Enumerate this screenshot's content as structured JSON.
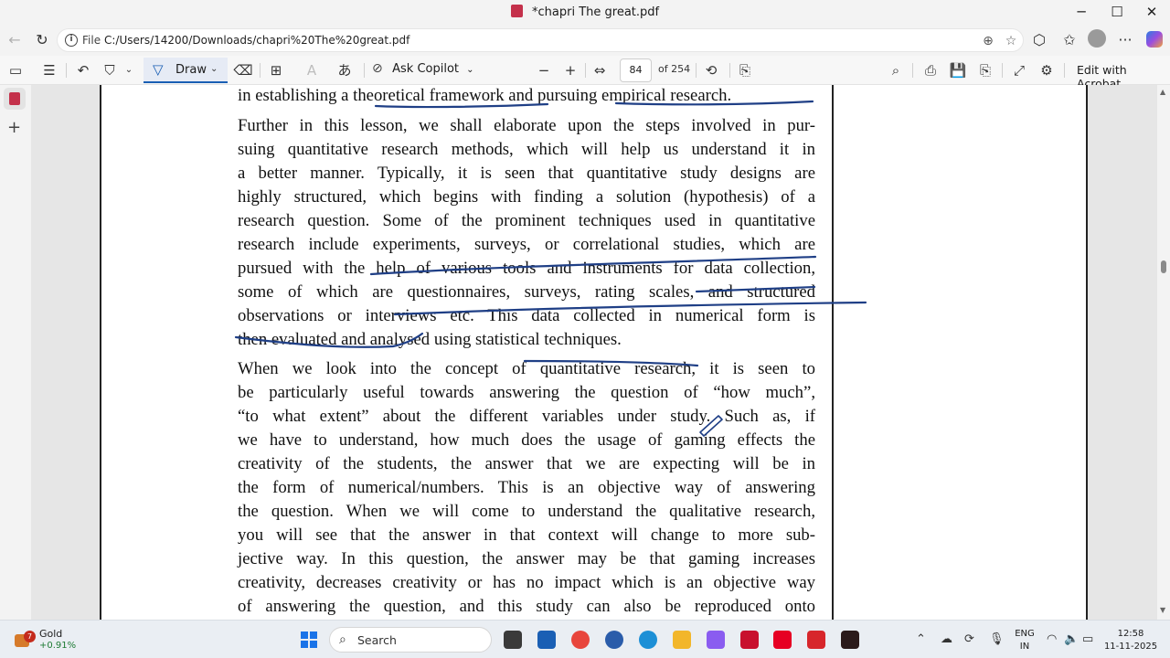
{
  "window": {
    "title": "*chapri The great.pdf",
    "minimize": "─",
    "maximize": "☐",
    "close": "✕"
  },
  "addressbar": {
    "back": "←",
    "refresh": "↻",
    "file_label": "File",
    "url": "C:/Users/14200/Downloads/chapri%20The%20great.pdf",
    "icons": {
      "zoom": "⊕",
      "favorite": "☆",
      "extensions": "⬡",
      "favorites_bar": "✩",
      "more": "···"
    }
  },
  "toolbar": {
    "sidebar_toggle": "▭",
    "contents": "☰",
    "undo": "↶",
    "highlight": "⛉",
    "highlight_caret": "⌄",
    "draw_icon": "▽",
    "draw_label": "Draw",
    "draw_caret": "⌄",
    "erase": "⌫",
    "text_box": "⊞",
    "text_style": "A",
    "read_aloud": "あ",
    "copilot_icon": "⊘",
    "ask_copilot": "Ask Copilot",
    "copilot_caret": "⌄",
    "zoom_out": "−",
    "zoom_in": "+",
    "fit": "⇔",
    "page_number": "84",
    "page_total": "of 254",
    "rotate": "⟲",
    "page_view": "⎘",
    "find": "⌕",
    "print": "⎙",
    "save": "💾",
    "save_as": "⎘",
    "fullscreen": "⤢",
    "settings": "⚙",
    "edit_with_acrobat": "Edit with Acrobat"
  },
  "sidebar": {
    "add": "+"
  },
  "document": {
    "paragraphs": [
      {
        "lines": [
          "in establishing a theoretical framework and pursuing empirical research."
        ]
      },
      {
        "lines": [
          "Further in this lesson, we shall elaborate upon the steps involved in pur-",
          "suing quantitative research methods, which will help us understand it in",
          "a better manner. Typically, it is seen that quantitative study designs are",
          "highly structured, which begins with finding a solution (hypothesis) of a",
          "research question. Some of the prominent techniques used in quantitative",
          "research include experiments, surveys, or correlational studies, which are",
          "pursued with the help of various tools and instruments for data collection,",
          "some of which are questionnaires, surveys, rating scales, and structured",
          "observations or interviews etc. This data collected in numerical form is",
          "then evaluated and analysed using statistical techniques."
        ]
      },
      {
        "lines": [
          "When we look into the concept of quantitative research, it is seen to",
          "be particularly useful towards answering the question of “how much”,",
          "“to what extent” about the different variables under study. Such as, if",
          "we have to understand, how much does the usage of gaming effects the",
          "creativity of the students, the answer that we are expecting will be in",
          "the form of numerical/numbers. This is an objective way of answering",
          "the question. When we will come to understand the qualitative research,",
          "you will see that the answer in that context will change to more sub-",
          "jective way. In this question, the answer may be that gaming increases",
          "creativity, decreases creativity or has no impact which is an objective way",
          "of answering the question, and this study can also be reproduced onto"
        ]
      }
    ]
  },
  "scrollbar": {
    "up": "▲",
    "down": "▼"
  },
  "taskbar": {
    "widget_badge": "7",
    "widget_name": "Gold",
    "widget_value": "+0.91%",
    "search_label": "Search",
    "search_icon": "⌕",
    "tray": {
      "chevron": "⌃",
      "language_top": "ENG",
      "language_bottom": "IN",
      "time": "12:58",
      "date": "11-11-2025"
    },
    "colors": {
      "accent": "#1a73e8",
      "ink": "#1f3f86"
    }
  }
}
